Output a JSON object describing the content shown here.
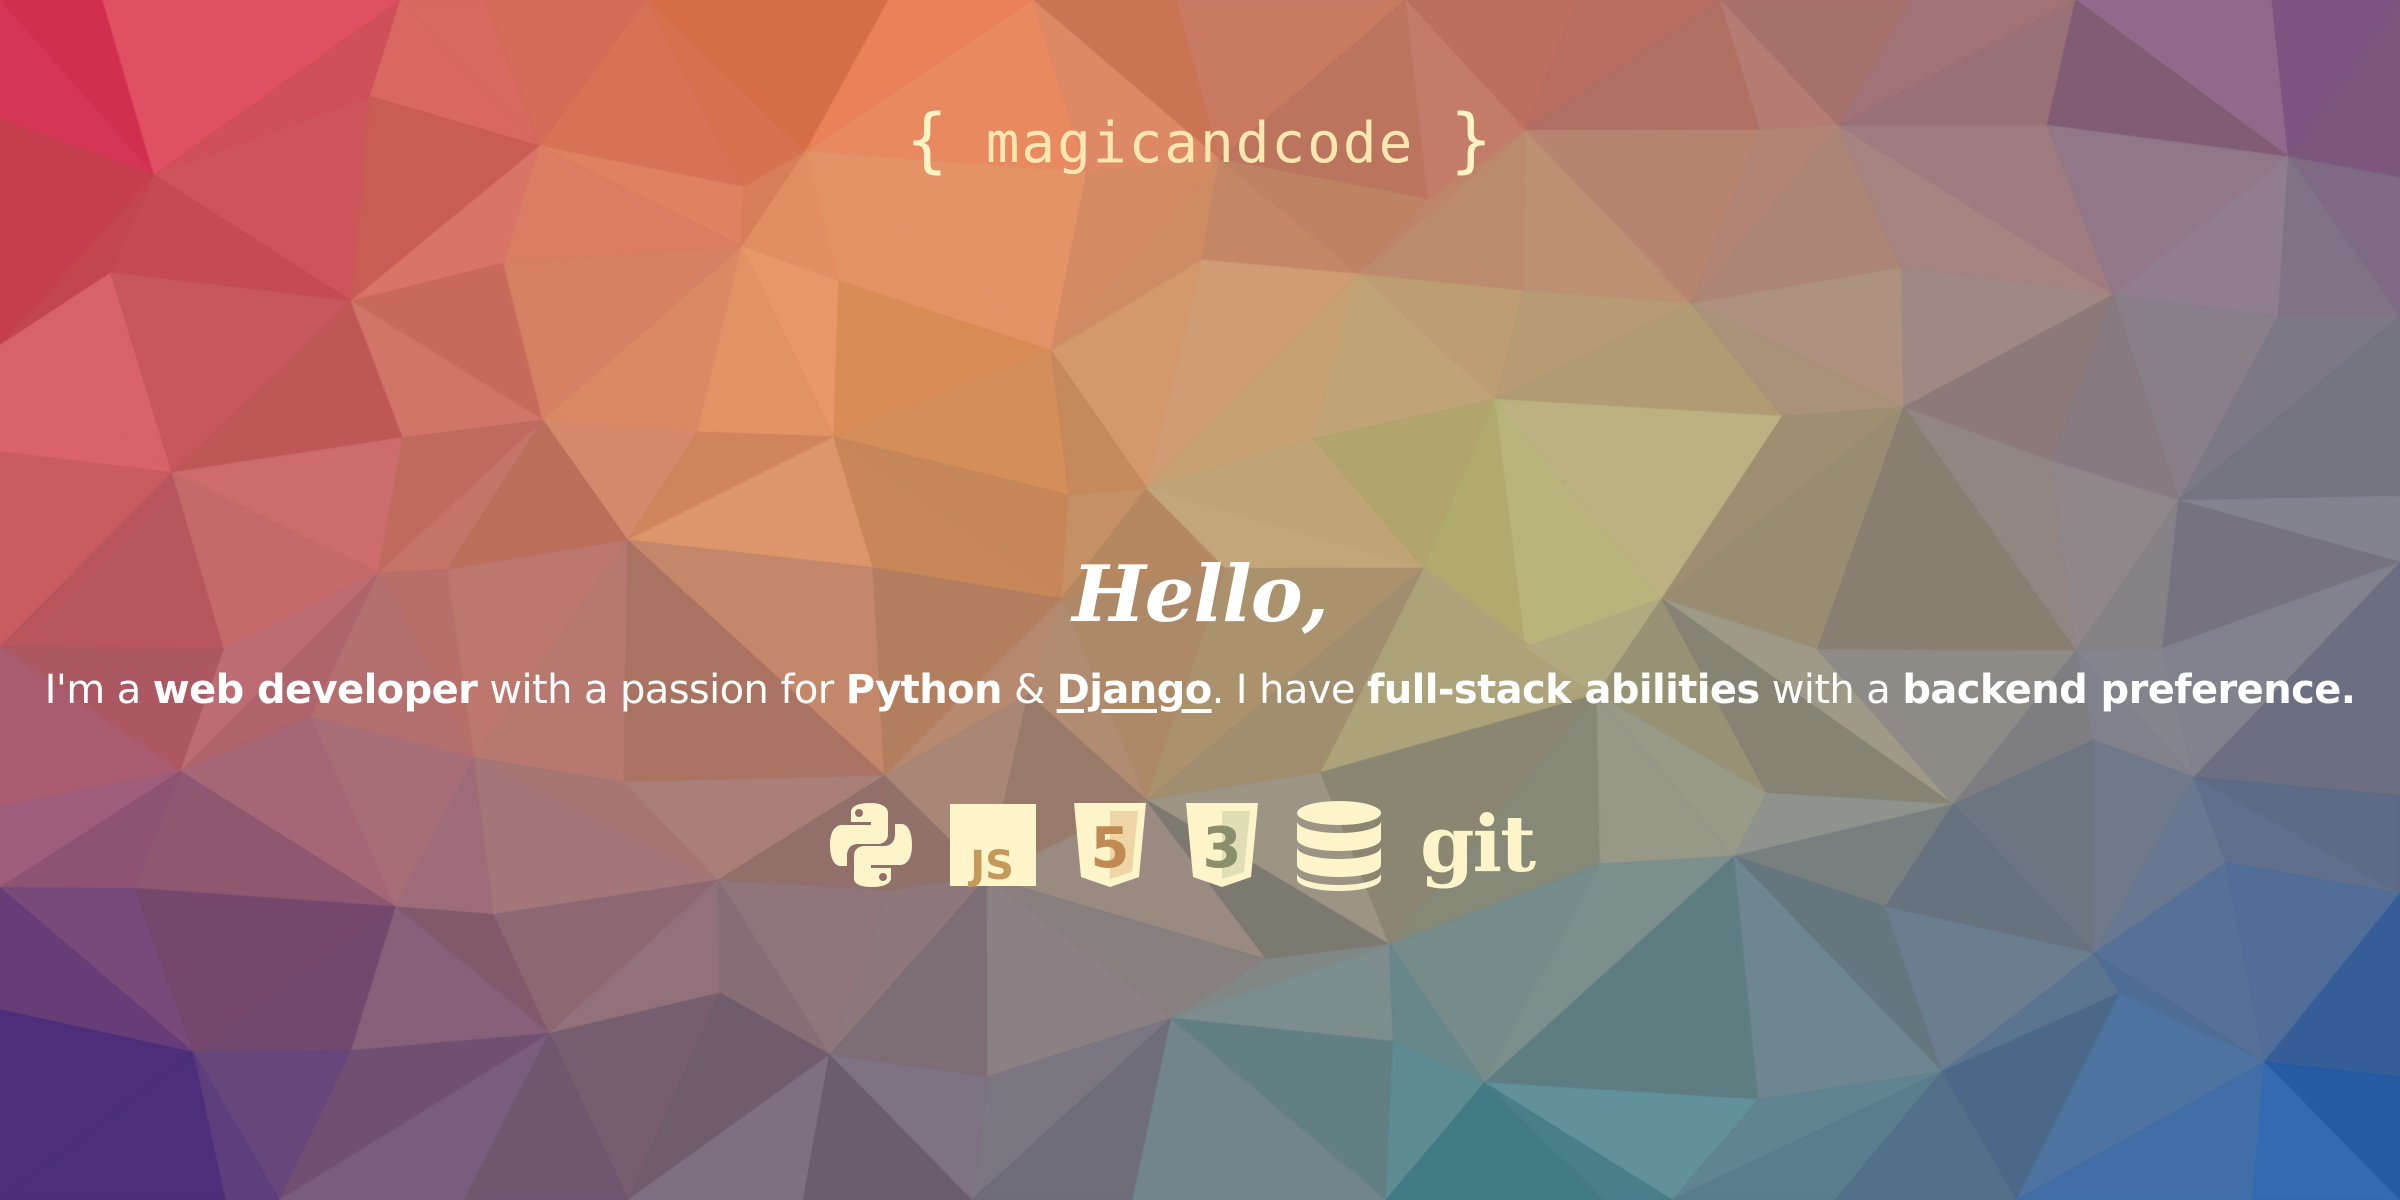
{
  "logo": {
    "open_brace": "{",
    "text": "magicandcode",
    "close_brace": "}"
  },
  "hero": {
    "greeting": "Hello,",
    "intro": {
      "p1": "I'm a ",
      "b1": "web developer",
      "p2": " with a passion for ",
      "b2": "Python",
      "p3": " & ",
      "link": "Django",
      "p4": ". I have ",
      "b3": "full-stack abilities",
      "p5": " with a ",
      "b4": "backend preference."
    }
  },
  "skills": [
    {
      "name": "python-icon"
    },
    {
      "name": "javascript-icon",
      "label": "JS"
    },
    {
      "name": "html5-icon",
      "label": "5"
    },
    {
      "name": "css3-icon",
      "label": "3"
    },
    {
      "name": "database-icon"
    },
    {
      "name": "git-icon",
      "label": "git"
    }
  ],
  "colors": {
    "icon": "#fdf5c9",
    "text": "#ffffff",
    "logo": "#fde7b0"
  }
}
